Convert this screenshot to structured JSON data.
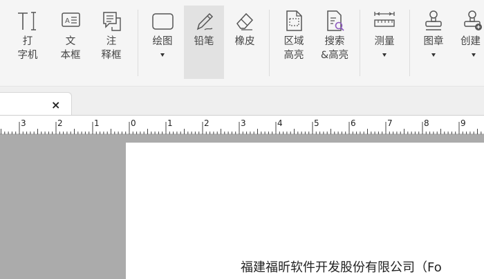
{
  "ribbon": {
    "tools": [
      {
        "id": "typewriter",
        "label1": "打",
        "label2": "字机",
        "icon": "typewriter-icon"
      },
      {
        "id": "textbox",
        "label1": "文",
        "label2": "本框",
        "icon": "textbox-icon"
      },
      {
        "id": "note",
        "label1": "注",
        "label2": "释框",
        "icon": "callout-icon"
      },
      {
        "id": "drawing",
        "label1": "绘图",
        "icon": "rectangle-icon"
      },
      {
        "id": "pencil",
        "label1": "铅笔",
        "icon": "pencil-icon"
      },
      {
        "id": "eraser",
        "label1": "橡皮",
        "icon": "eraser-icon"
      },
      {
        "id": "area-highlight",
        "label1": "区域",
        "label2": "高亮",
        "icon": "area-highlight-icon"
      },
      {
        "id": "search-highlight",
        "label1": "搜索",
        "label2": "&高亮",
        "icon": "search-highlight-icon"
      },
      {
        "id": "measure",
        "label1": "测量",
        "icon": "ruler-icon"
      },
      {
        "id": "stamp",
        "label1": "图章",
        "icon": "stamp-icon"
      },
      {
        "id": "create",
        "label1": "创建",
        "icon": "create-stamp-icon"
      }
    ]
  },
  "tab": {
    "close_glyph": "×"
  },
  "ruler": {
    "labels": [
      "3",
      "2",
      "1",
      "0",
      "1",
      "2",
      "3",
      "4",
      "5",
      "6",
      "7",
      "8",
      "9"
    ]
  },
  "document": {
    "company_text": "福建福昕软件开发股份有限公司（Fo"
  },
  "colors": {
    "accent": "#7a3fa0",
    "canvas": "#ababab",
    "ribbon": "#f5f5f5"
  }
}
